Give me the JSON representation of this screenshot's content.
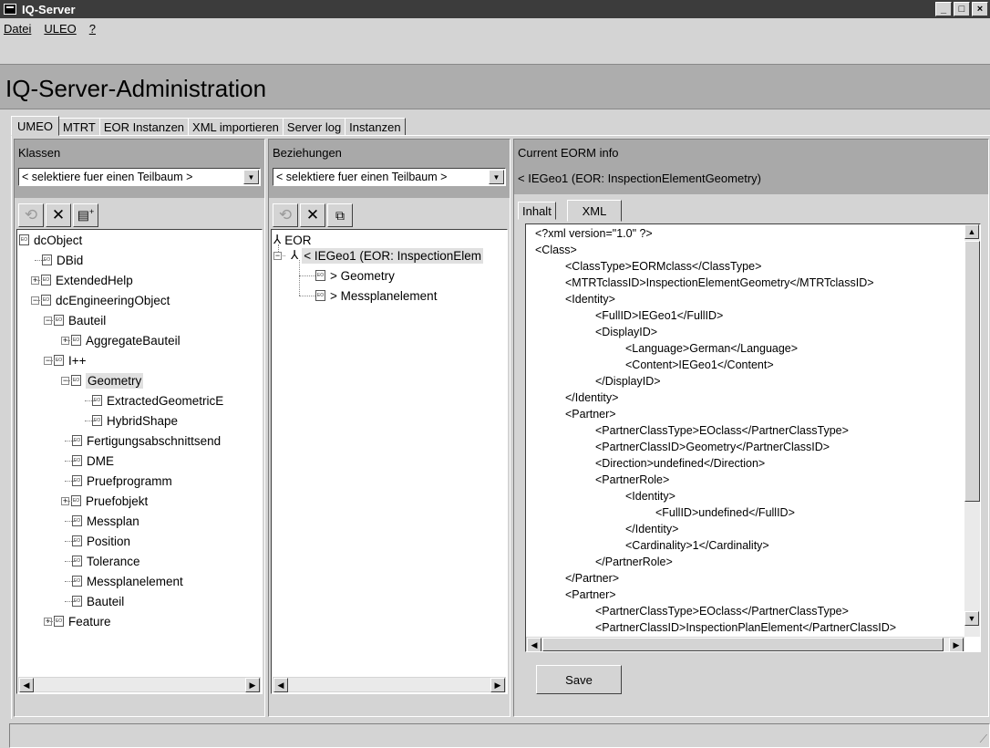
{
  "window": {
    "title": "IQ-Server",
    "min": "_",
    "max": "□",
    "close": "×"
  },
  "menu": [
    "Datei",
    "ULEO",
    "?"
  ],
  "app_title": "IQ-Server-Administration",
  "tabs": [
    "UMEO",
    "MTRT",
    "EOR Instanzen",
    "XML importieren",
    "Server log",
    "Instanzen"
  ],
  "classes": {
    "label": "Klassen",
    "combo": "< selektiere fuer einen Teilbaum >",
    "items": [
      {
        "label": "dcObject",
        "depth": 0,
        "exp": ""
      },
      {
        "label": "DBid",
        "depth": 1,
        "exp": ""
      },
      {
        "label": "ExtendedHelp",
        "depth": 1,
        "exp": "+"
      },
      {
        "label": "dcEngineeringObject",
        "depth": 1,
        "exp": "-"
      },
      {
        "label": "Bauteil",
        "depth": 2,
        "exp": "-"
      },
      {
        "label": "AggregateBauteil",
        "depth": 3,
        "exp": "+"
      },
      {
        "label": "I++",
        "depth": 2,
        "exp": "-"
      },
      {
        "label": "Geometry",
        "depth": 3,
        "exp": "-",
        "selected": true
      },
      {
        "label": "ExtractedGeometricE",
        "depth": 4,
        "exp": ""
      },
      {
        "label": "HybridShape",
        "depth": 4,
        "exp": ""
      },
      {
        "label": "Fertigungsabschnittsend",
        "depth": 3,
        "exp": ""
      },
      {
        "label": "DME",
        "depth": 3,
        "exp": ""
      },
      {
        "label": "Pruefprogramm",
        "depth": 3,
        "exp": ""
      },
      {
        "label": "Pruefobjekt",
        "depth": 3,
        "exp": "+"
      },
      {
        "label": "Messplan",
        "depth": 3,
        "exp": ""
      },
      {
        "label": "Position",
        "depth": 3,
        "exp": ""
      },
      {
        "label": "Tolerance",
        "depth": 3,
        "exp": ""
      },
      {
        "label": "Messplanelement",
        "depth": 3,
        "exp": ""
      },
      {
        "label": "Bauteil",
        "depth": 3,
        "exp": ""
      },
      {
        "label": "Feature",
        "depth": 2,
        "exp": "+"
      }
    ]
  },
  "relations": {
    "label": "Beziehungen",
    "combo": "< selektiere fuer einen Teilbaum >",
    "root": "EOR",
    "node": "< IEGeo1 (EOR: InspectionElem",
    "children": [
      "> Geometry",
      "> Messplanelement"
    ]
  },
  "info": {
    "label": "Current EORM info",
    "subtitle": "< IEGeo1 (EOR: InspectionElementGeometry)",
    "tabs": [
      "Inhalt",
      "XML"
    ],
    "save": "Save",
    "xml": [
      {
        "t": "<?xml version=\"1.0\" ?>",
        "i": 0
      },
      {
        "t": "<Class>",
        "i": 0
      },
      {
        "t": "<ClassType>EORMclass</ClassType>",
        "i": 1
      },
      {
        "t": "<MTRTclassID>InspectionElementGeometry</MTRTclassID>",
        "i": 1
      },
      {
        "t": "<Identity>",
        "i": 1
      },
      {
        "t": "<FullID>IEGeo1</FullID>",
        "i": 2
      },
      {
        "t": "<DisplayID>",
        "i": 2
      },
      {
        "t": "<Language>German</Language>",
        "i": 3
      },
      {
        "t": "<Content>IEGeo1</Content>",
        "i": 3
      },
      {
        "t": "</DisplayID>",
        "i": 2
      },
      {
        "t": "</Identity>",
        "i": 1
      },
      {
        "t": "<Partner>",
        "i": 1
      },
      {
        "t": "<PartnerClassType>EOclass</PartnerClassType>",
        "i": 2
      },
      {
        "t": "<PartnerClassID>Geometry</PartnerClassID>",
        "i": 2
      },
      {
        "t": "<Direction>undefined</Direction>",
        "i": 2
      },
      {
        "t": "<PartnerRole>",
        "i": 2
      },
      {
        "t": "<Identity>",
        "i": 3
      },
      {
        "t": "<FullID>undefined</FullID>",
        "i": 4
      },
      {
        "t": "</Identity>",
        "i": 3
      },
      {
        "t": "<Cardinality>1</Cardinality>",
        "i": 3
      },
      {
        "t": "</PartnerRole>",
        "i": 2
      },
      {
        "t": "</Partner>",
        "i": 1
      },
      {
        "t": "<Partner>",
        "i": 1
      },
      {
        "t": "<PartnerClassType>EOclass</PartnerClassType>",
        "i": 2
      },
      {
        "t": "<PartnerClassID>InspectionPlanElement</PartnerClassID>",
        "i": 2
      }
    ]
  }
}
